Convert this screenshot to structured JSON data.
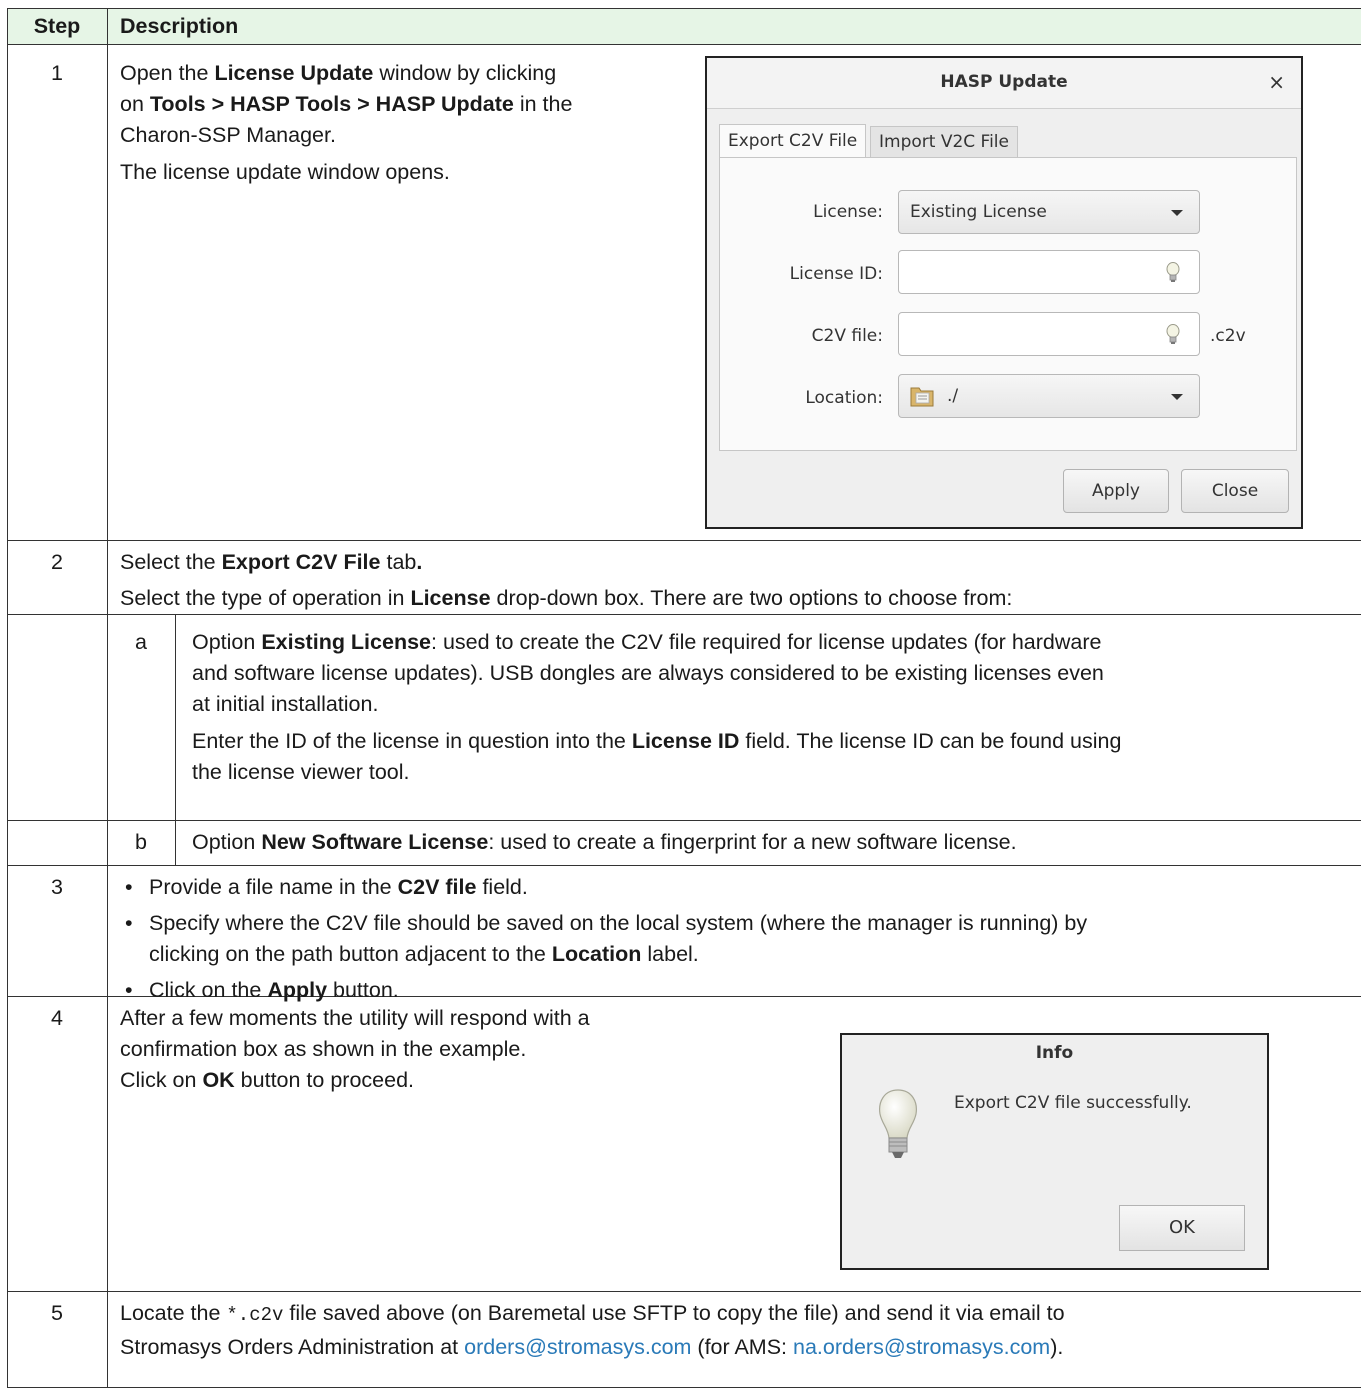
{
  "table": {
    "header": {
      "step": "Step",
      "description": "Description"
    },
    "steps": [
      {
        "number": "1",
        "line1": {
          "a": "Open the ",
          "b": "License Update",
          "c": " window by clicking"
        },
        "line2": {
          "a": "on ",
          "b": "Tools > HASP Tools > HASP Update",
          "c": " in the"
        },
        "line3": "Charon-SSP Manager.",
        "line4": "The license update window opens."
      },
      {
        "number": "2",
        "line1": {
          "a": "Select the ",
          "b": "Export C2V File",
          "c": " tab",
          "d": "."
        },
        "line2": {
          "a": "Select the type of operation in ",
          "b": "License",
          "c": " drop-down box. There are two options to choose from:"
        },
        "sub_a": {
          "letter": "a",
          "line1": {
            "a": "Option ",
            "b": "Existing License",
            "c": ": used to create the C2V file required for license updates (for hardware"
          },
          "line2": "and software license updates). USB dongles are always considered to be existing licenses even",
          "line3": "at initial installation.",
          "line4": {
            "a": "Enter the ID of the license in question into the ",
            "b": "License ID",
            "c": " field. The license ID can be found using"
          },
          "line5": "the license viewer tool."
        },
        "sub_b": {
          "letter": "b",
          "line1": {
            "a": "Option ",
            "b": "New Software License",
            "c": ": used to create a fingerprint for a new software license."
          }
        }
      },
      {
        "number": "3",
        "bullet1": {
          "a": "Provide a file name in the ",
          "b": "C2V file",
          "c": " field."
        },
        "bullet2": {
          "a": "Specify where the C2V file should be saved on the local system (where the manager is running) by"
        },
        "bullet2b": {
          "a": "clicking on the path button adjacent to the ",
          "b": "Location",
          "c": " label."
        },
        "bullet3": {
          "a": "Click on the ",
          "b": "Apply",
          "c": " button."
        }
      },
      {
        "number": "4",
        "line1": "After a few moments the utility will respond with a",
        "line2": "confirmation box as shown in the example.",
        "line3": {
          "a": "Click on ",
          "b": "OK",
          "c": " button to proceed."
        }
      },
      {
        "number": "5",
        "line1": {
          "a": "Locate the ",
          "b": "*.c2v",
          "c": " file saved above (on Baremetal use SFTP to copy the file) and send it via email to"
        },
        "line2": {
          "a": "Stromasys Orders Administration at ",
          "b": "orders@stromasys.com",
          "c": " (for AMS: ",
          "d": "na.orders@stromasys.com",
          "e": ")."
        }
      }
    ]
  },
  "hasp_dialog": {
    "title": "HASP Update",
    "close_symbol": "×",
    "tabs": [
      "Export C2V File",
      "Import V2C File"
    ],
    "fields": {
      "license_label": "License:",
      "license_value": "Existing License",
      "license_id_label": "License ID:",
      "license_id_value": "",
      "c2v_label": "C2V file:",
      "c2v_value": "",
      "c2v_suffix": ".c2v",
      "location_label": "Location:",
      "location_value": "./"
    },
    "buttons": {
      "apply": "Apply",
      "close": "Close"
    }
  },
  "info_dialog": {
    "title": "Info",
    "message": "Export C2V file successfully.",
    "ok": "OK"
  },
  "colors": {
    "header_bg": "#e6f5e6",
    "link": "#2a7ab8",
    "border": "#333333"
  }
}
